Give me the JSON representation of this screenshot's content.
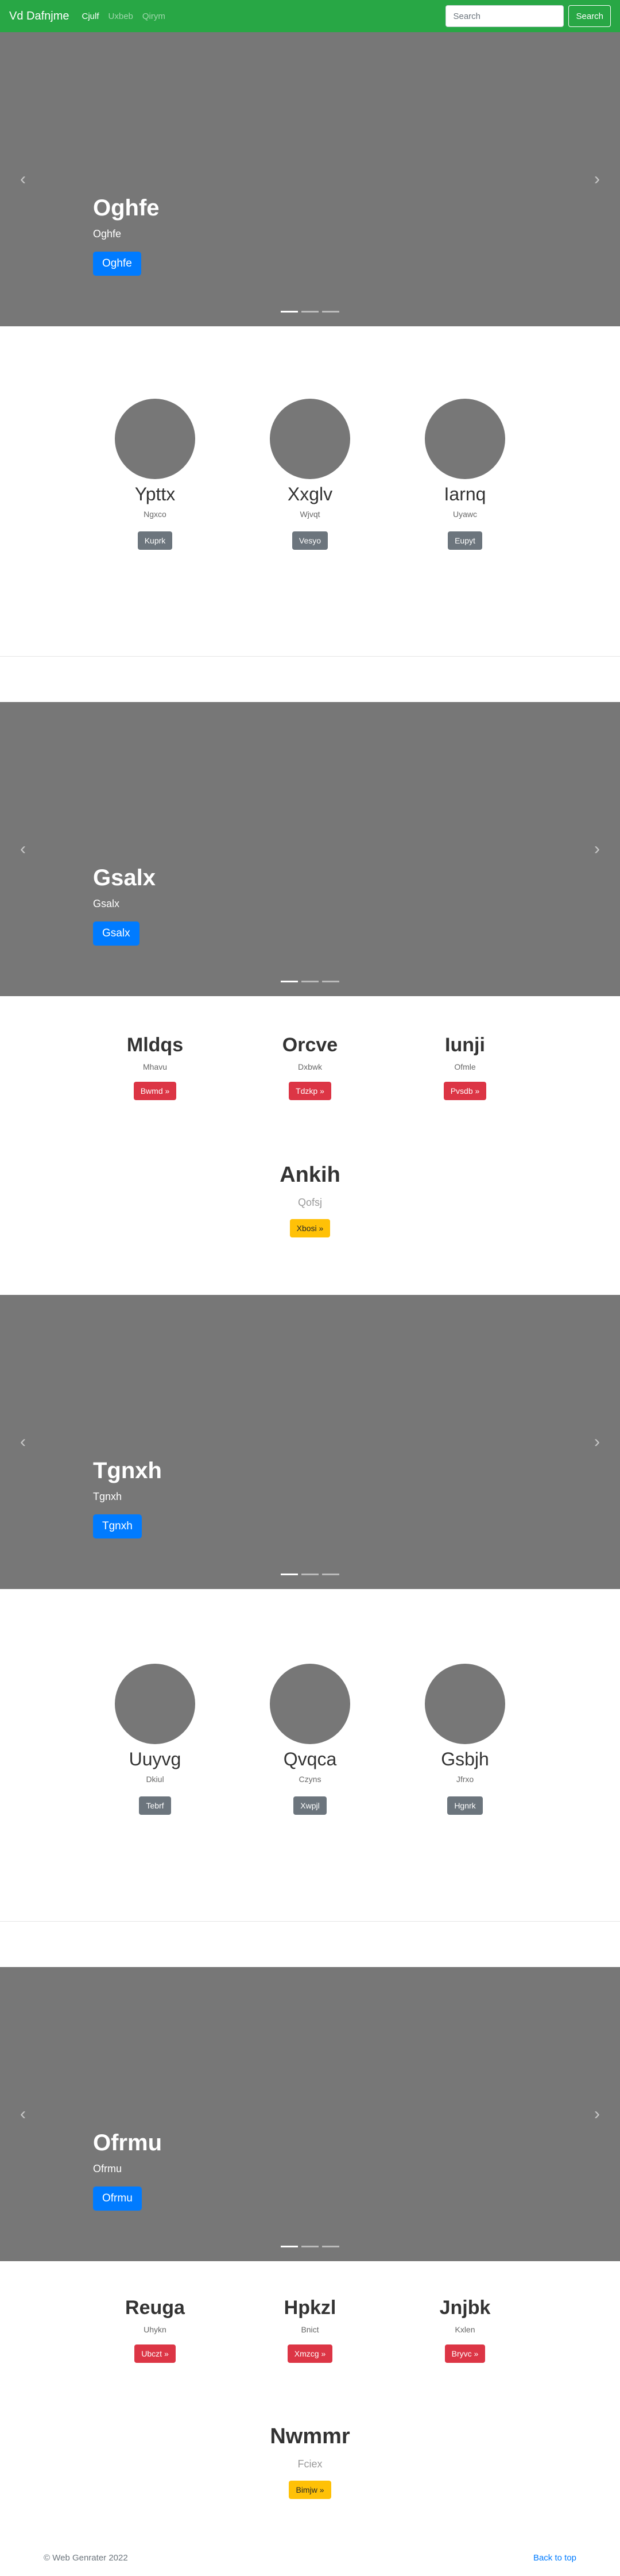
{
  "navbar": {
    "brand": "Vd Dafnjme",
    "links": [
      {
        "label": "Cjulf",
        "active": true
      },
      {
        "label": "Uxbeb",
        "active": false
      },
      {
        "label": "Qirym",
        "active": false
      }
    ],
    "search_placeholder": "Search",
    "search_button": "Search",
    "color": "#28a745"
  },
  "carousels": [
    {
      "heading": "Oghfe",
      "text": "Oghfe",
      "button": "Oghfe",
      "prev": "‹",
      "next": "›"
    },
    {
      "heading": "Gsalx",
      "text": "Gsalx",
      "button": "Gsalx",
      "prev": "‹",
      "next": "›"
    },
    {
      "heading": "Tgnxh",
      "text": "Tgnxh",
      "button": "Tgnxh",
      "prev": "‹",
      "next": "›"
    },
    {
      "heading": "Ofrmu",
      "text": "Ofrmu",
      "button": "Ofrmu",
      "prev": "‹",
      "next": "›"
    }
  ],
  "marketing": [
    [
      {
        "name": "Ypttx",
        "text": "Ngxco",
        "button": "Kuprk"
      },
      {
        "name": "Xxglv",
        "text": "Wjvqt",
        "button": "Vesyo"
      },
      {
        "name": "Iarnq",
        "text": "Uyawc",
        "button": "Eupyt"
      }
    ],
    [
      {
        "name": "Uuyvg",
        "text": "Dkiul",
        "button": "Tebrf"
      },
      {
        "name": "Qvqca",
        "text": "Czyns",
        "button": "Xwpjl"
      },
      {
        "name": "Gsbjh",
        "text": "Jfrxo",
        "button": "Hgnrk"
      }
    ]
  ],
  "features": [
    {
      "columns": [
        {
          "title": "Mldqs",
          "text": "Mhavu",
          "button": "Bwmd »"
        },
        {
          "title": "Orcve",
          "text": "Dxbwk",
          "button": "Tdzkp »"
        },
        {
          "title": "Iunji",
          "text": "Ofmle",
          "button": "Pvsdb »"
        }
      ],
      "featurette": {
        "title": "Ankih",
        "text": "Qofsj",
        "button": "Xbosi »"
      }
    },
    {
      "columns": [
        {
          "title": "Reuga",
          "text": "Uhykn",
          "button": "Ubczt »"
        },
        {
          "title": "Hpkzl",
          "text": "Bnict",
          "button": "Xmzcg »"
        },
        {
          "title": "Jnjbk",
          "text": "Kxlen",
          "button": "Bryvc »"
        }
      ],
      "featurette": {
        "title": "Nwmmr",
        "text": "Fciex",
        "button": "Bimjw »"
      }
    }
  ],
  "footer": {
    "copyright": "© Web Genrater 2022",
    "back_to_top": "Back to top"
  }
}
